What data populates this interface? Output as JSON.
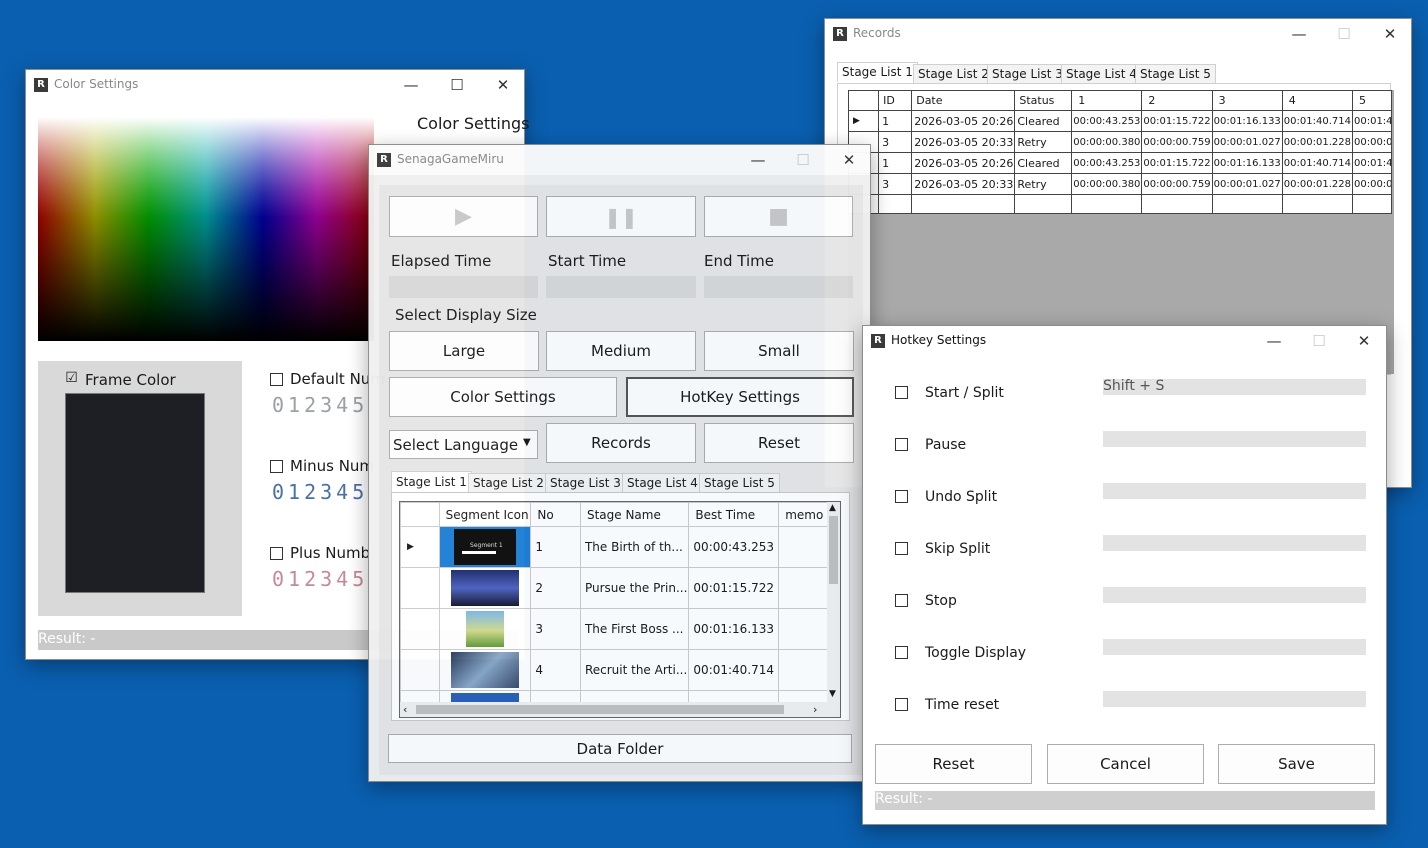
{
  "records_window": {
    "title": "Records",
    "controls": {
      "minimize": "—",
      "maximize": "☐",
      "close": "✕"
    },
    "tabs": [
      {
        "label": "Stage List 1"
      },
      {
        "label": "Stage List 2"
      },
      {
        "label": "Stage List 3"
      },
      {
        "label": "Stage List 4"
      },
      {
        "label": "Stage List 5"
      }
    ],
    "columns": [
      "ID",
      "Date",
      "Status",
      "1",
      "2",
      "3",
      "4",
      "5"
    ],
    "rows": [
      {
        "cells": [
          "1",
          "2026-03-05 20:26",
          "Cleared",
          "00:00:43.253",
          "00:01:15.722",
          "00:01:16.133",
          "00:01:40.714",
          "00:01:4"
        ]
      },
      {
        "cells": [
          "3",
          "2026-03-05 20:33",
          "Retry",
          "00:00:00.380",
          "00:00:00.759",
          "00:00:01.027",
          "00:00:01.228",
          "00:00:0"
        ]
      },
      {
        "cells": [
          "1",
          "2026-03-05 20:26",
          "Cleared",
          "00:00:43.253",
          "00:01:15.722",
          "00:01:16.133",
          "00:01:40.714",
          "00:01:4"
        ]
      },
      {
        "cells": [
          "3",
          "2026-03-05 20:33",
          "Retry",
          "00:00:00.380",
          "00:00:00.759",
          "00:00:01.027",
          "00:00:01.228",
          "00:00:0"
        ]
      }
    ]
  },
  "color_window": {
    "title": "Color Settings",
    "heading": "Color Settings",
    "frame_color_label": "Frame Color",
    "frame_color_checked": "☑",
    "default_number_label": "Default Num",
    "minus_number_label": "Minus Num",
    "plus_number_label": "Plus Numb",
    "digits": "012345",
    "result": "Result: -"
  },
  "main_window": {
    "title": "SenagaGameMiru",
    "play_icon": "▶",
    "pause_icon": "❚❚",
    "stop_icon": "■",
    "elapsed_label": "Elapsed Time",
    "start_label": "Start Time",
    "end_label": "End Time",
    "display_size_label": "Select Display Size",
    "large": "Large",
    "medium": "Medium",
    "small": "Small",
    "color_settings": "Color Settings",
    "hotkey_settings": "HotKey Settings",
    "select_language": "Select Language",
    "records": "Records",
    "reset": "Reset",
    "data_folder": "Data Folder",
    "tabs": [
      {
        "label": "Stage List 1"
      },
      {
        "label": "Stage List 2"
      },
      {
        "label": "Stage List 3"
      },
      {
        "label": "Stage List 4"
      },
      {
        "label": "Stage List 5"
      }
    ],
    "columns": [
      "Segment Icon",
      "No",
      "Stage Name",
      "Best Time",
      "memo"
    ],
    "rows": [
      {
        "icon_text": "Segment 1",
        "no": "1",
        "name": "The Birth of th...",
        "best": "00:00:43.253"
      },
      {
        "icon_text": "",
        "no": "2",
        "name": "Pursue the Prin...",
        "best": "00:01:15.722"
      },
      {
        "icon_text": "",
        "no": "3",
        "name": "The First Boss ...",
        "best": "00:01:16.133"
      },
      {
        "icon_text": "",
        "no": "4",
        "name": "Recruit the Arti...",
        "best": "00:01:40.714"
      }
    ]
  },
  "hotkey_window": {
    "title": "Hotkey Settings",
    "items": [
      {
        "label": "Start / Split",
        "value": "Shift + S"
      },
      {
        "label": "Pause",
        "value": ""
      },
      {
        "label": "Undo Split",
        "value": ""
      },
      {
        "label": "Skip Split",
        "value": ""
      },
      {
        "label": "Stop",
        "value": ""
      },
      {
        "label": "Toggle Display",
        "value": ""
      },
      {
        "label": "Time reset",
        "value": ""
      }
    ],
    "reset": "Reset",
    "cancel": "Cancel",
    "save": "Save",
    "result": "Result: -"
  }
}
